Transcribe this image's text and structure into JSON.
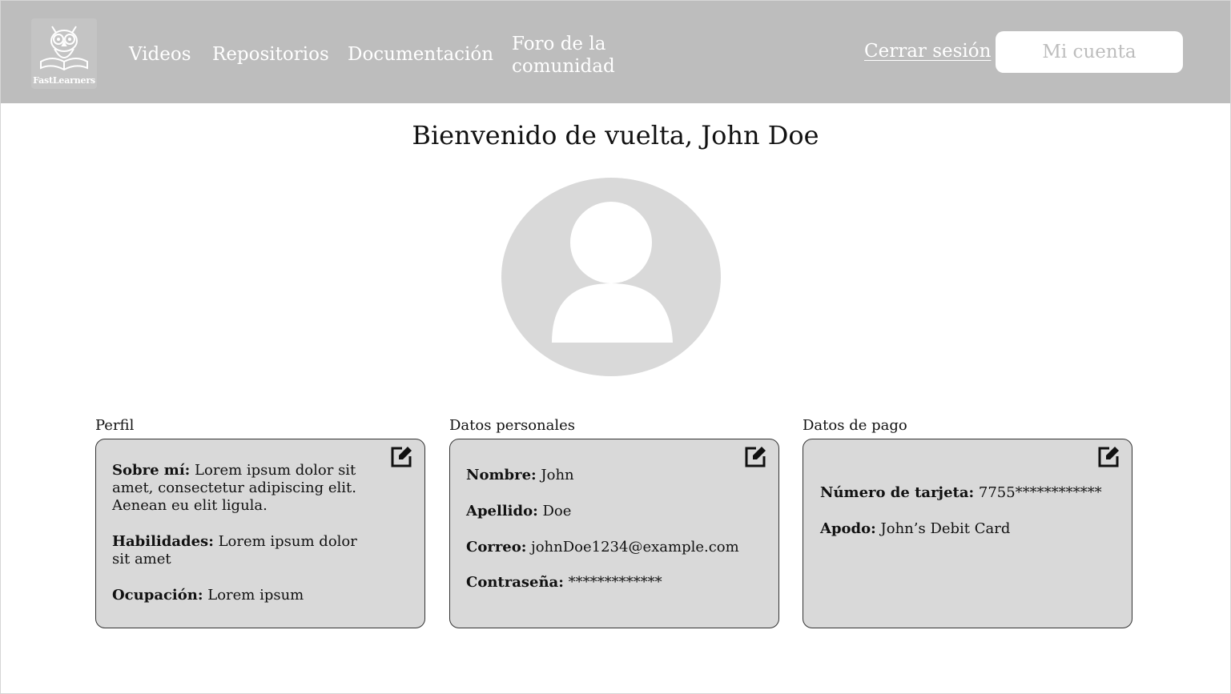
{
  "brand": {
    "name": "FastLearners",
    "logo_icon": "owl-book-icon"
  },
  "nav": {
    "videos": "Videos",
    "repositorios": "Repositorios",
    "documentacion": "Documentación",
    "foro": "Foro de la comunidad"
  },
  "header": {
    "logout": "Cerrar sesión",
    "account": "Mi cuenta"
  },
  "welcome": "Bienvenido de vuelta, John Doe",
  "avatar_icon": "user-avatar-icon",
  "perfil": {
    "title": "Perfil",
    "sobre_label": "Sobre mí:",
    "sobre_value": " Lorem ipsum dolor sit amet, consectetur adipiscing elit. Aenean eu elit  ligula.",
    "habilidades_label": "Habilidades:",
    "habilidades_value": " Lorem ipsum dolor sit amet",
    "ocupacion_label": "Ocupación:",
    "ocupacion_value": " Lorem ipsum"
  },
  "personales": {
    "title": "Datos personales",
    "nombre_label": "Nombre:",
    "nombre_value": " John",
    "apellido_label": "Apellido:",
    "apellido_value": " Doe",
    "correo_label": "Correo:",
    "correo_value": " johnDoe1234@example.com",
    "contrasena_label": "Contraseña:",
    "contrasena_value": " *************"
  },
  "pago": {
    "title": "Datos de pago",
    "tarjeta_label": "Número de tarjeta:",
    "tarjeta_value": " 7755************",
    "apodo_label": "Apodo:",
    "apodo_value": " John’s Debit Card"
  },
  "colors": {
    "header_bg": "#bdbdbd",
    "card_bg": "#d9d9d9",
    "avatar_bg": "#d9d9d9"
  }
}
